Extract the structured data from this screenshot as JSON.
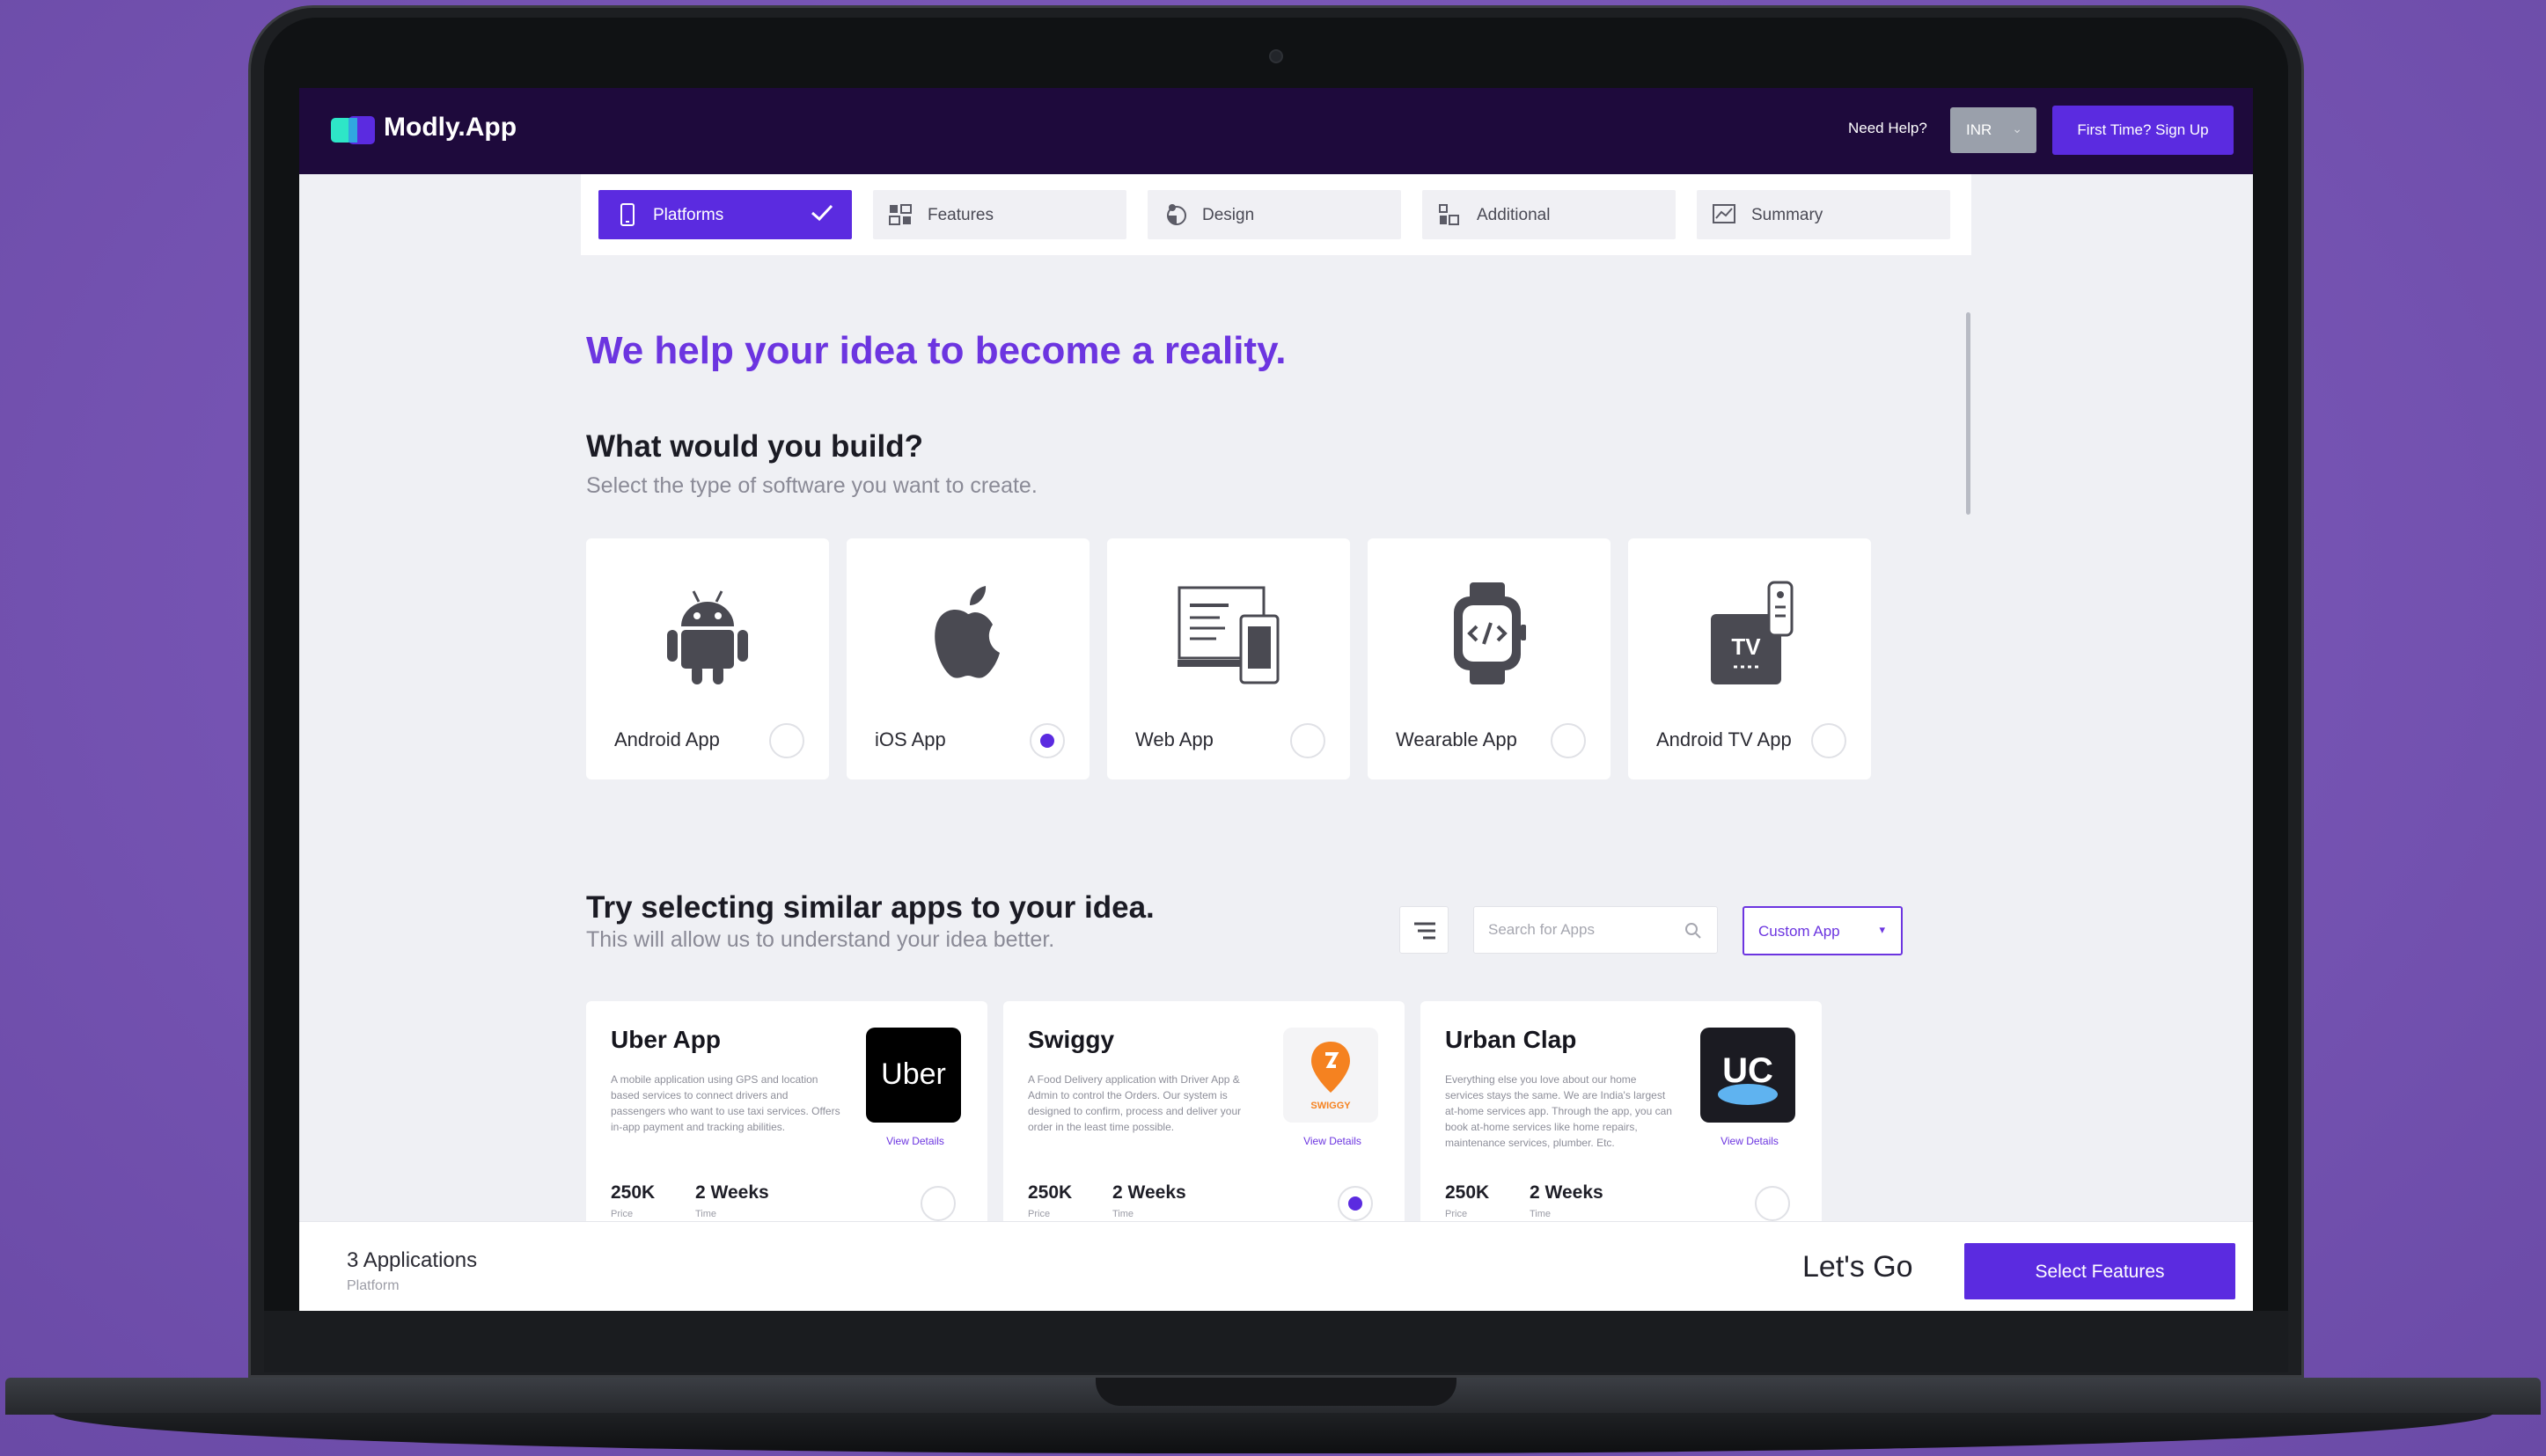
{
  "header": {
    "brand": "Modly.App",
    "help": "Need Help?",
    "currency": "INR",
    "signup": "First Time? Sign Up"
  },
  "tabs": [
    {
      "label": "Platforms",
      "active": true,
      "icon": "phone-icon"
    },
    {
      "label": "Features",
      "active": false,
      "icon": "features-icon"
    },
    {
      "label": "Design",
      "active": false,
      "icon": "design-icon"
    },
    {
      "label": "Additional",
      "active": false,
      "icon": "additional-icon"
    },
    {
      "label": "Summary",
      "active": false,
      "icon": "summary-icon"
    }
  ],
  "hero": "We help your idea to become a reality.",
  "build": {
    "title": "What would you build?",
    "subtitle": "Select the type of software you want to create."
  },
  "platforms": [
    {
      "label": "Android App",
      "selected": false,
      "icon": "android-icon"
    },
    {
      "label": "iOS App",
      "selected": true,
      "icon": "apple-icon"
    },
    {
      "label": "Web App",
      "selected": false,
      "icon": "web-devices-icon"
    },
    {
      "label": "Wearable App",
      "selected": false,
      "icon": "smartwatch-icon"
    },
    {
      "label": "Android TV App",
      "selected": false,
      "icon": "tv-icon"
    }
  ],
  "similar": {
    "title": "Try selecting similar apps to your idea.",
    "subtitle": "This will allow us to understand your idea better.",
    "search_placeholder": "Search for Apps",
    "custom_app": "Custom App"
  },
  "apps": [
    {
      "name": "Uber App",
      "description": "A mobile application using GPS and location based services to connect drivers and passengers who want to use taxi services. Offers in-app payment and tracking abilities.",
      "link": "View Details",
      "price": "250K",
      "price_label": "Price",
      "time": "2 Weeks",
      "time_label": "Time",
      "selected": false,
      "logo_text": "Uber"
    },
    {
      "name": "Swiggy",
      "description": "A Food Delivery application with Driver App & Admin to control the Orders. Our system is designed to confirm, process and deliver your order in the least time possible.",
      "link": "View Details",
      "price": "250K",
      "price_label": "Price",
      "time": "2 Weeks",
      "time_label": "Time",
      "selected": true,
      "logo_text": "SWIGGY"
    },
    {
      "name": "Urban Clap",
      "description": "Everything else you love about our home services stays the same. We are India's largest at-home services app. Through the app, you can book at-home services like home repairs, maintenance services, plumber. Etc.",
      "link": "View Details",
      "price": "250K",
      "price_label": "Price",
      "time": "2 Weeks",
      "time_label": "Time",
      "selected": false,
      "logo_text": "UC"
    }
  ],
  "footer": {
    "count": "3 Applications",
    "sub": "Platform",
    "lets_go": "Let's Go",
    "button": "Select Features"
  },
  "colors": {
    "accent": "#5b2be0",
    "hero": "#6c35e0",
    "topbar": "#1e0a3c",
    "background": "#7c5ab8"
  }
}
